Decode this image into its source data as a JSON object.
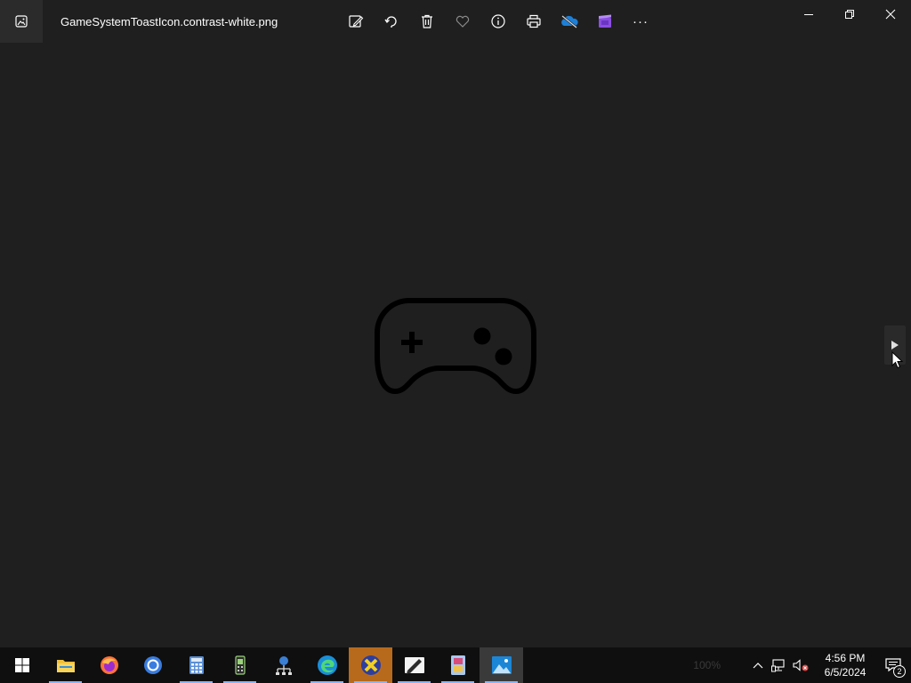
{
  "window": {
    "title": "GameSystemToastIcon.contrast-white.png"
  },
  "toolbar": {
    "items": [
      {
        "name": "edit-image-icon"
      },
      {
        "name": "rotate-icon"
      },
      {
        "name": "delete-icon"
      },
      {
        "name": "favorite-heart-icon"
      },
      {
        "name": "info-icon"
      },
      {
        "name": "print-icon"
      },
      {
        "name": "onedrive-icon"
      },
      {
        "name": "video-editor-icon"
      },
      {
        "name": "more-options-icon"
      }
    ],
    "more_label": "···"
  },
  "window_controls": {
    "minimize": "minimize-icon",
    "restore": "restore-icon",
    "close": "close-icon"
  },
  "viewer": {
    "image_subject": "gamepad-icon",
    "next_button": "next-arrow-icon"
  },
  "taskbar": {
    "apps": [
      {
        "name": "start-button"
      },
      {
        "name": "file-explorer",
        "running": true
      },
      {
        "name": "firefox"
      },
      {
        "name": "chrome"
      },
      {
        "name": "calculator",
        "running": true
      },
      {
        "name": "phone-app",
        "running": true
      },
      {
        "name": "network-app"
      },
      {
        "name": "edge",
        "running": true
      },
      {
        "name": "xbox-app",
        "running": true
      },
      {
        "name": "draw-app",
        "running": true
      },
      {
        "name": "archive-app",
        "running": true
      },
      {
        "name": "photos-app",
        "running": true,
        "active": true
      }
    ],
    "zoom": "100%",
    "time": "4:56 PM",
    "date": "6/5/2024",
    "notification_count": "2"
  },
  "colors": {
    "background": "#1f1f1f",
    "taskbar": "#0f0f0f",
    "accent": "#8ab4f8"
  }
}
